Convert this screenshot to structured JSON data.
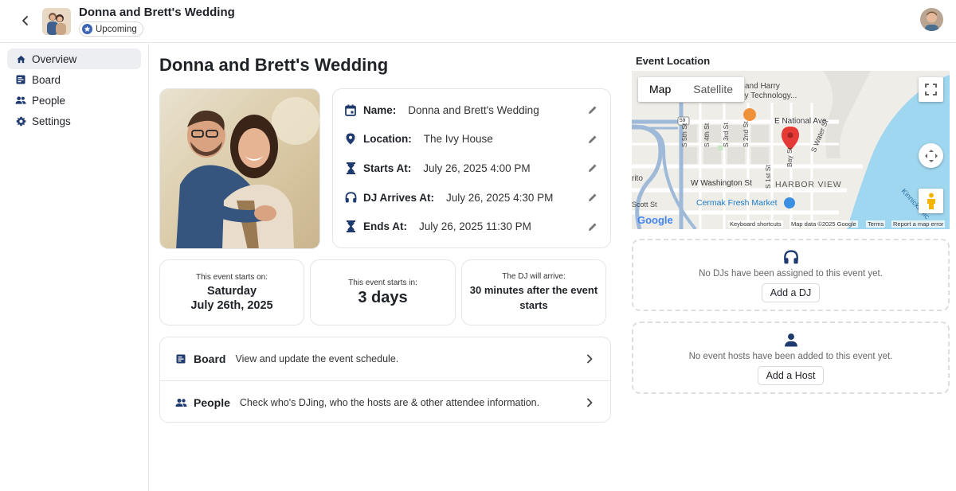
{
  "header": {
    "title": "Donna and Brett's Wedding",
    "status": "Upcoming"
  },
  "sidebar": {
    "items": [
      {
        "label": "Overview",
        "icon": "home-icon"
      },
      {
        "label": "Board",
        "icon": "board-icon"
      },
      {
        "label": "People",
        "icon": "people-icon"
      },
      {
        "label": "Settings",
        "icon": "gear-icon"
      }
    ]
  },
  "main": {
    "title": "Donna and Brett's Wedding",
    "details": [
      {
        "label": "Name:",
        "value": "Donna and Brett's Wedding",
        "icon": "calendar-icon"
      },
      {
        "label": "Location:",
        "value": "The Ivy House",
        "icon": "location-pin-icon"
      },
      {
        "label": "Starts At:",
        "value": "July 26, 2025 4:00 PM",
        "icon": "hourglass-icon"
      },
      {
        "label": "DJ Arrives At:",
        "value": "July 26, 2025 4:30 PM",
        "icon": "headphones-icon"
      },
      {
        "label": "Ends At:",
        "value": "July 26, 2025 11:30 PM",
        "icon": "hourglass-icon"
      }
    ],
    "info_cards": {
      "starts_on": {
        "caption": "This event starts on:",
        "line1": "Saturday",
        "line2": "July 26th, 2025"
      },
      "starts_in": {
        "caption": "This event starts in:",
        "value": "3 days"
      },
      "dj_arrive": {
        "caption": "The DJ will arrive:",
        "line1": "30 minutes after the event",
        "line2": "starts"
      }
    },
    "links": [
      {
        "title": "Board",
        "desc": "View and update the event schedule.",
        "icon": "board-icon"
      },
      {
        "title": "People",
        "desc": "Check who's DJing, who the hosts are & other attendee information.",
        "icon": "people-icon"
      }
    ]
  },
  "location": {
    "title": "Event Location",
    "map": {
      "tabs": [
        "Map",
        "Satellite"
      ],
      "labels": {
        "harry": "and Harry",
        "tech": "ey Technology...",
        "national": "E National Ave",
        "water": "S Water St",
        "s5": "S 5th St",
        "s4": "S 4th St",
        "s3": "S 3rd St",
        "s2": "S 2nd St",
        "s1": "S 1st St",
        "bay": "Bay St",
        "rito": "rito",
        "washington": "W Washington St",
        "harbor": "HARBOR VIEW",
        "cermak": "Cermak Fresh Market",
        "scott": "Scott St",
        "kinnick": "Kinnickinnic",
        "route": "59"
      },
      "google": "Google",
      "footer": {
        "shortcuts": "Keyboard shortcuts",
        "mapdata": "Map data ©2025 Google",
        "terms": "Terms",
        "report": "Report a map error"
      }
    },
    "dj_empty": {
      "text": "No DJs have been assigned to this event yet.",
      "button": "Add a DJ"
    },
    "host_empty": {
      "text": "No event hosts have been added to this event yet.",
      "button": "Add a Host"
    }
  },
  "colors": {
    "accent": "#1e3a6e",
    "water": "#9fd6f0",
    "pin": "#e53935"
  }
}
